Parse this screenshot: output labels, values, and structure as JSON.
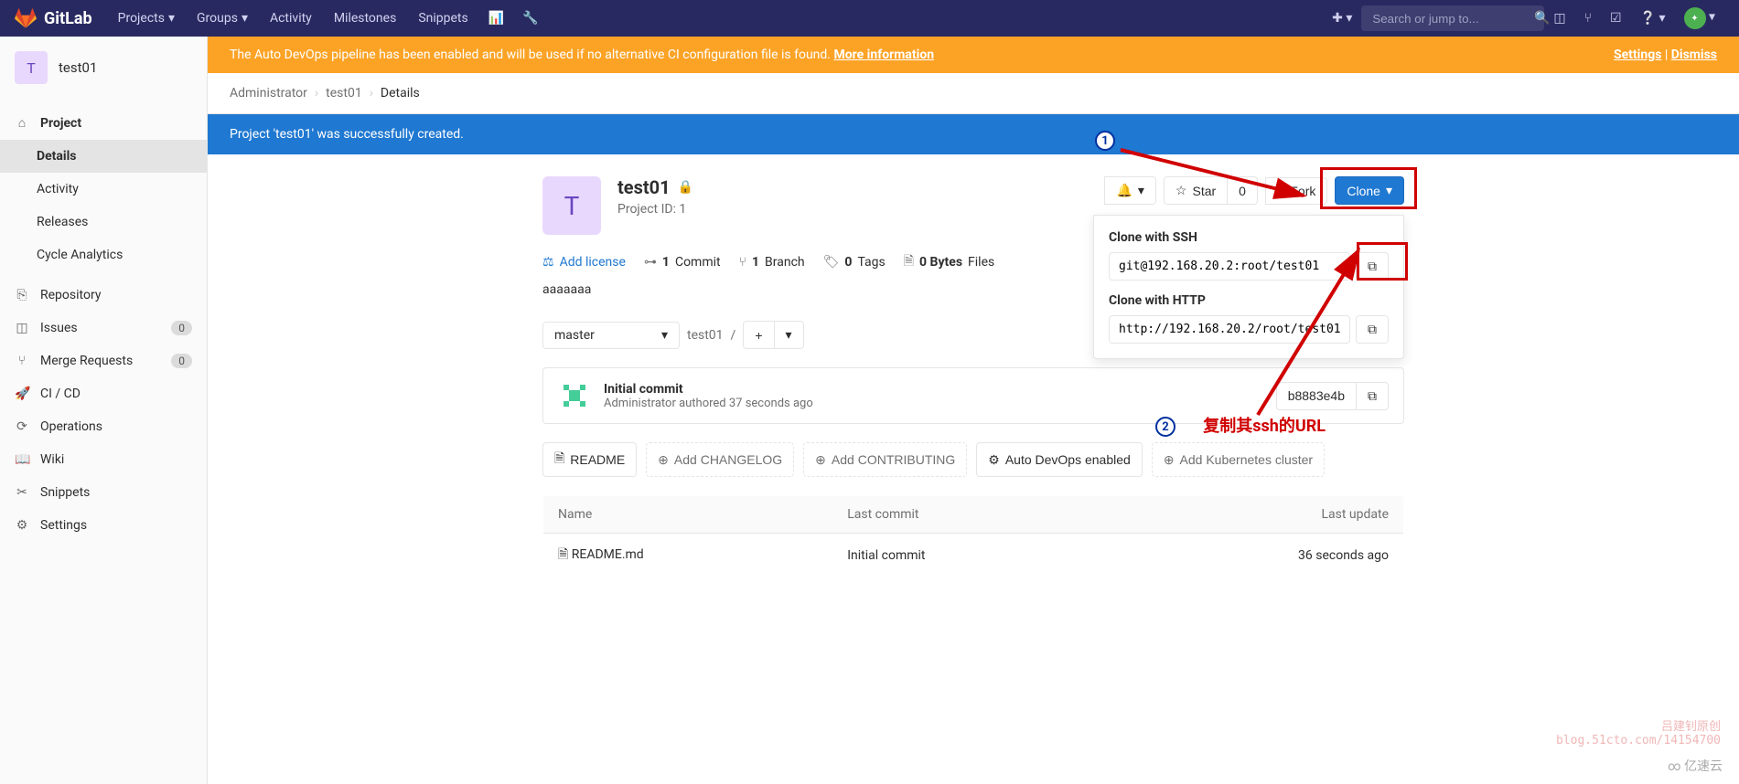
{
  "navbar": {
    "brand": "GitLab",
    "items": {
      "projects": "Projects",
      "groups": "Groups",
      "activity": "Activity",
      "milestones": "Milestones",
      "snippets": "Snippets"
    },
    "search_placeholder": "Search or jump to..."
  },
  "sidebar": {
    "project_letter": "T",
    "project_name": "test01",
    "items": {
      "project": "Project",
      "details": "Details",
      "activity": "Activity",
      "releases": "Releases",
      "cycle": "Cycle Analytics",
      "repository": "Repository",
      "issues": "Issues",
      "issues_count": "0",
      "merge": "Merge Requests",
      "merge_count": "0",
      "cicd": "CI / CD",
      "operations": "Operations",
      "wiki": "Wiki",
      "snippets": "Snippets",
      "settings": "Settings"
    }
  },
  "banners": {
    "devops_text": "The Auto DevOps pipeline has been enabled and will be used if no alternative CI configuration file is found. ",
    "devops_link": "More information",
    "settings": "Settings",
    "dismiss": "Dismiss",
    "success": "Project 'test01' was successfully created."
  },
  "breadcrumbs": {
    "c1": "Administrator",
    "c2": "test01",
    "c3": "Details"
  },
  "project": {
    "avatar_letter": "T",
    "name": "test01",
    "id_label": "Project ID: 1",
    "description": "aaaaaaa",
    "actions": {
      "star": "Star",
      "star_count": "0",
      "fork": "Fork",
      "clone": "Clone"
    },
    "stats": {
      "add_license": "Add license",
      "commits_n": "1",
      "commits_l": " Commit",
      "branch_n": "1",
      "branch_l": " Branch",
      "tags_n": "0",
      "tags_l": " Tags",
      "bytes_n": "0 Bytes",
      "bytes_l": " Files"
    },
    "ref": {
      "branch": "master",
      "path": "test01",
      "sep": "/"
    },
    "commit": {
      "title": "Initial commit",
      "meta": "Administrator authored 37 seconds ago",
      "sha": "b8883e4b"
    },
    "quick": {
      "readme": "README",
      "changelog": "Add CHANGELOG",
      "contributing": "Add CONTRIBUTING",
      "autodevops": "Auto DevOps enabled",
      "k8s": "Add Kubernetes cluster"
    },
    "files": {
      "h_name": "Name",
      "h_commit": "Last commit",
      "h_update": "Last update",
      "r1_name": "README.md",
      "r1_commit": "Initial commit",
      "r1_update": "36 seconds ago"
    }
  },
  "clone_panel": {
    "ssh_label": "Clone with SSH",
    "ssh_url": "git@192.168.20.2:root/test01",
    "http_label": "Clone with HTTP",
    "http_url": "http://192.168.20.2/root/test01"
  },
  "annotations": {
    "n1": "1",
    "n2": "2",
    "t2": "复制其ssh的URL"
  },
  "watermark": {
    "l1": "吕建钊原创",
    "l2": "blog.51cto.com/14154700",
    "logo": "∞ 亿速云"
  }
}
